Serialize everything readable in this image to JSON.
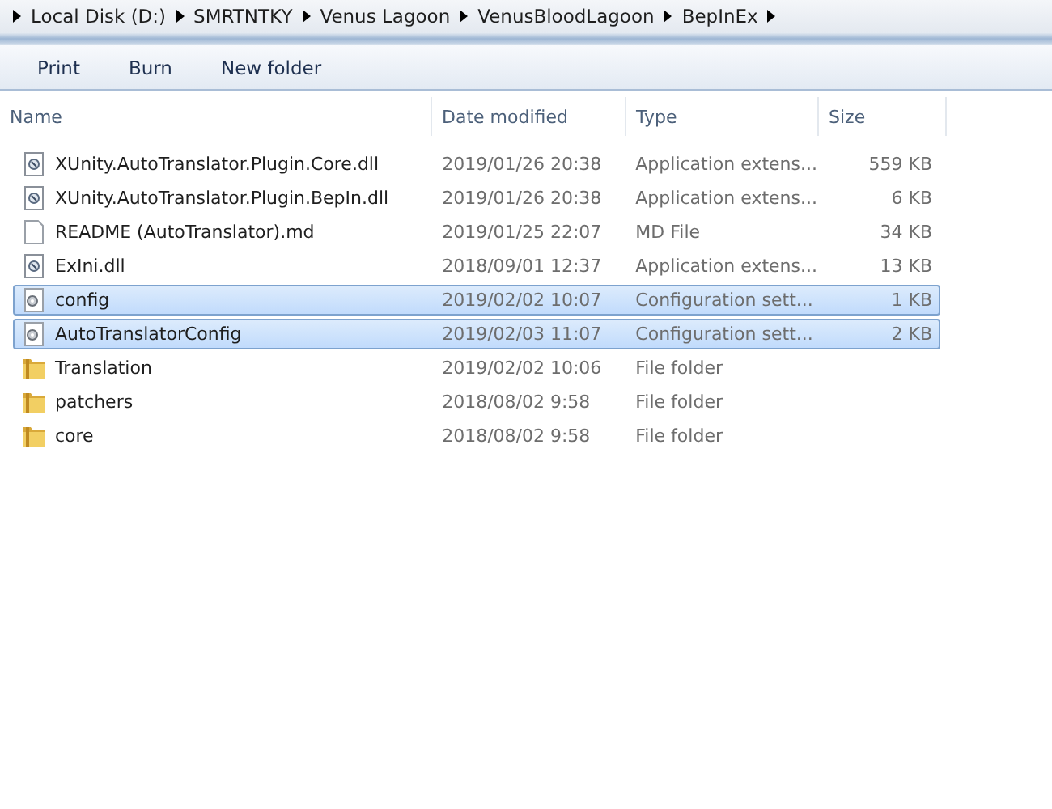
{
  "breadcrumb": [
    "Local Disk (D:)",
    "SMRTNTKY",
    "Venus Lagoon",
    "VenusBloodLagoon",
    "BepInEx"
  ],
  "toolbar": [
    "Print",
    "Burn",
    "New folder"
  ],
  "columns": [
    "Name",
    "Date modified",
    "Type",
    "Size"
  ],
  "rows": [
    {
      "kind": "dll",
      "name": "XUnity.AutoTranslator.Plugin.Core.dll",
      "date": "2019/01/26 20:38",
      "type": "Application extens...",
      "size": "559 KB",
      "selected": false
    },
    {
      "kind": "dll",
      "name": "XUnity.AutoTranslator.Plugin.BepIn.dll",
      "date": "2019/01/26 20:38",
      "type": "Application extens...",
      "size": "6 KB",
      "selected": false
    },
    {
      "kind": "file",
      "name": "README (AutoTranslator).md",
      "date": "2019/01/25 22:07",
      "type": "MD File",
      "size": "34 KB",
      "selected": false
    },
    {
      "kind": "dll",
      "name": "ExIni.dll",
      "date": "2018/09/01 12:37",
      "type": "Application extens...",
      "size": "13 KB",
      "selected": false
    },
    {
      "kind": "config",
      "name": "config",
      "date": "2019/02/02 10:07",
      "type": "Configuration sett...",
      "size": "1 KB",
      "selected": true
    },
    {
      "kind": "config",
      "name": "AutoTranslatorConfig",
      "date": "2019/02/03 11:07",
      "type": "Configuration sett...",
      "size": "2 KB",
      "selected": true
    },
    {
      "kind": "folder",
      "name": "Translation",
      "date": "2019/02/02 10:06",
      "type": "File folder",
      "selected": false
    },
    {
      "kind": "folder",
      "name": "patchers",
      "date": "2018/08/02 9:58",
      "type": "File folder",
      "selected": false
    },
    {
      "kind": "folder",
      "name": "core",
      "date": "2018/08/02 9:58",
      "type": "File folder",
      "selected": false
    }
  ]
}
